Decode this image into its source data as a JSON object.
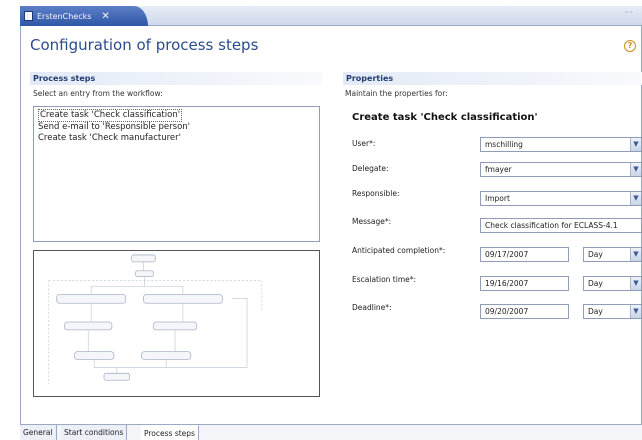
{
  "editor_tab": {
    "label": "ErstenChecks",
    "close": "✕"
  },
  "page": {
    "title": "Configuration of process steps",
    "help": "?"
  },
  "process_steps": {
    "header": "Process steps",
    "description": "Select an entry from the workflow:",
    "items": [
      "Create task 'Check classification'",
      "Send e-mail to 'Responsible person'",
      "Create task 'Check manufacturer'"
    ]
  },
  "properties": {
    "header": "Properties",
    "description": "Maintain the properties for:",
    "task_title": "Create task 'Check classification'",
    "fields": {
      "user": {
        "label": "User*:",
        "value": "mschilling"
      },
      "delegate": {
        "label": "Delegate:",
        "value": "fmayer"
      },
      "responsible": {
        "label": "Responsible:",
        "value": "Import"
      },
      "message": {
        "label": "Message*:",
        "value": "Check classification for ECLASS-4.1"
      },
      "anticipated": {
        "label": "Anticipated completion*:",
        "value": "09/17/2007",
        "unit": "Day"
      },
      "escalation": {
        "label": "Escalation time*:",
        "value": "19/16/2007",
        "unit": "Day"
      },
      "deadline": {
        "label": "Deadline*:",
        "value": "09/20/2007",
        "unit": "Day"
      }
    }
  },
  "bottom_tabs": [
    "General",
    "Start conditions",
    "Process steps"
  ],
  "colors": {
    "accent": "#2b4c8c",
    "tab": "#2f56a8",
    "border": "#9aa9c4"
  }
}
